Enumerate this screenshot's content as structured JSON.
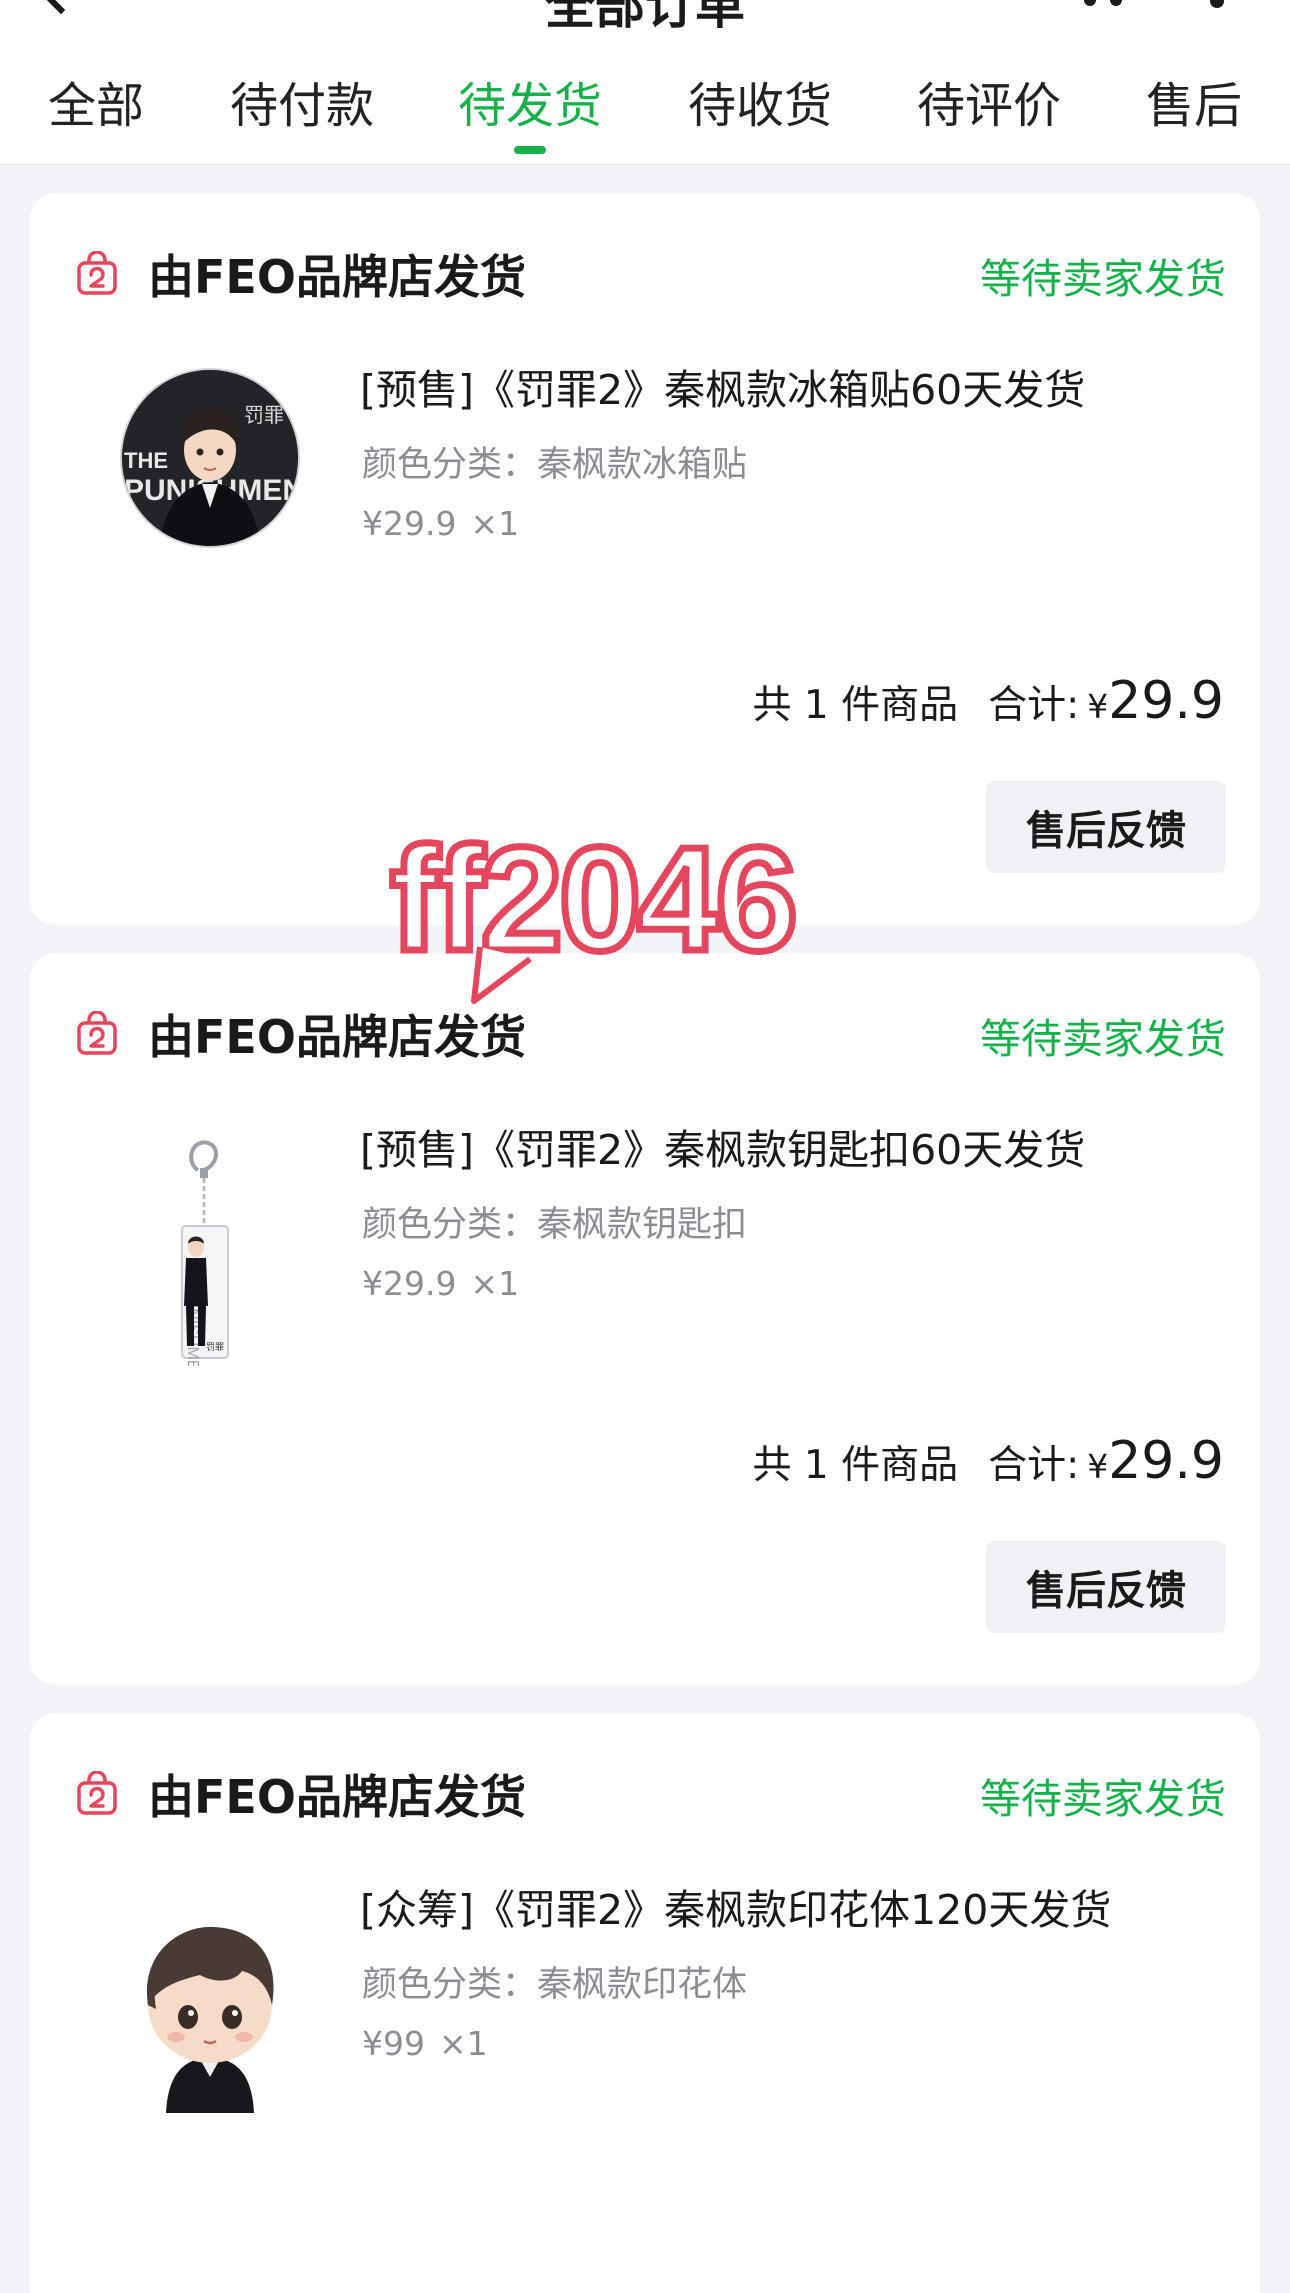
{
  "header": {
    "title": "全部订单"
  },
  "tabs": [
    {
      "label": "全部"
    },
    {
      "label": "待付款"
    },
    {
      "label": "待发货"
    },
    {
      "label": "待收货"
    },
    {
      "label": "待评价"
    },
    {
      "label": "售后"
    }
  ],
  "active_tab": "待发货",
  "colors": {
    "accent_green": "#17b14b",
    "store_icon_red": "#e4475d",
    "background": "#f1f3f7"
  },
  "icons": {
    "back": "back-chevron-icon",
    "more": "more-dots-icon",
    "store": "shopping-bag-icon"
  },
  "orders": [
    {
      "store_name": "由FEO品牌店发货",
      "status": "等待卖家发货",
      "product_title": "[预售]《罚罪2》秦枫款冰箱贴60天发货",
      "variant": "颜色分类：秦枫款冰箱贴",
      "price": "¥29.9",
      "quantity": "×1",
      "count_text": "共 1 件商品",
      "total_label": "合计:",
      "currency": "¥",
      "total_amount": "29.9",
      "action_label": "售后反馈"
    },
    {
      "store_name": "由FEO品牌店发货",
      "status": "等待卖家发货",
      "product_title": "[预售]《罚罪2》秦枫款钥匙扣60天发货",
      "variant": "颜色分类：秦枫款钥匙扣",
      "price": "¥29.9",
      "quantity": "×1",
      "count_text": "共 1 件商品",
      "total_label": "合计:",
      "currency": "¥",
      "total_amount": "29.9",
      "action_label": "售后反馈"
    },
    {
      "store_name": "由FEO品牌店发货",
      "status": "等待卖家发货",
      "product_title": "[众筹]《罚罪2》秦枫款印花体120天发货",
      "variant": "颜色分类：秦枫款印花体",
      "price": "¥99",
      "quantity": "×1"
    }
  ],
  "watermark": "ff2046"
}
